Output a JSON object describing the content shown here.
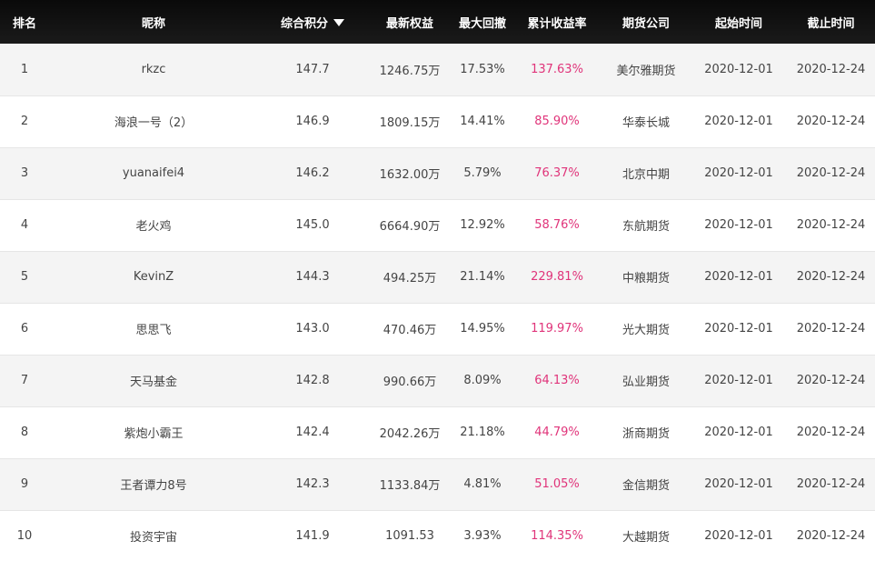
{
  "table": {
    "headers": {
      "rank": "排名",
      "nickname": "昵称",
      "score": "综合积分",
      "equity": "最新权益",
      "drawdown": "最大回撤",
      "return_rate": "累计收益率",
      "broker": "期货公司",
      "start": "起始时间",
      "end": "截止时间"
    },
    "sort_icon": "caret-down-icon",
    "accent_color": "#e0347a",
    "header_bg": "#0c0c0c",
    "rows": [
      {
        "rank": "1",
        "nickname": "rkzc",
        "score": "147.7",
        "equity": "1246.75万",
        "drawdown": "17.53%",
        "return_rate": "137.63%",
        "broker": "美尔雅期货",
        "start": "2020-12-01",
        "end": "2020-12-24"
      },
      {
        "rank": "2",
        "nickname": "海浪一号（2）",
        "score": "146.9",
        "equity": "1809.15万",
        "drawdown": "14.41%",
        "return_rate": "85.90%",
        "broker": "华泰长城",
        "start": "2020-12-01",
        "end": "2020-12-24"
      },
      {
        "rank": "3",
        "nickname": "yuanaifei4",
        "score": "146.2",
        "equity": "1632.00万",
        "drawdown": "5.79%",
        "return_rate": "76.37%",
        "broker": "北京中期",
        "start": "2020-12-01",
        "end": "2020-12-24"
      },
      {
        "rank": "4",
        "nickname": "老火鸡",
        "score": "145.0",
        "equity": "6664.90万",
        "drawdown": "12.92%",
        "return_rate": "58.76%",
        "broker": "东航期货",
        "start": "2020-12-01",
        "end": "2020-12-24"
      },
      {
        "rank": "5",
        "nickname": "KevinZ",
        "score": "144.3",
        "equity": "494.25万",
        "drawdown": "21.14%",
        "return_rate": "229.81%",
        "broker": "中粮期货",
        "start": "2020-12-01",
        "end": "2020-12-24"
      },
      {
        "rank": "6",
        "nickname": "思思飞",
        "score": "143.0",
        "equity": "470.46万",
        "drawdown": "14.95%",
        "return_rate": "119.97%",
        "broker": "光大期货",
        "start": "2020-12-01",
        "end": "2020-12-24"
      },
      {
        "rank": "7",
        "nickname": "天马基金",
        "score": "142.8",
        "equity": "990.66万",
        "drawdown": "8.09%",
        "return_rate": "64.13%",
        "broker": "弘业期货",
        "start": "2020-12-01",
        "end": "2020-12-24"
      },
      {
        "rank": "8",
        "nickname": "紫炮小霸王",
        "score": "142.4",
        "equity": "2042.26万",
        "drawdown": "21.18%",
        "return_rate": "44.79%",
        "broker": "浙商期货",
        "start": "2020-12-01",
        "end": "2020-12-24"
      },
      {
        "rank": "9",
        "nickname": "王者谭力8号",
        "score": "142.3",
        "equity": "1133.84万",
        "drawdown": "4.81%",
        "return_rate": "51.05%",
        "broker": "金信期货",
        "start": "2020-12-01",
        "end": "2020-12-24"
      },
      {
        "rank": "10",
        "nickname": "投资宇宙",
        "score": "141.9",
        "equity": "1091.53",
        "drawdown": "3.93%",
        "return_rate": "114.35%",
        "broker": "大越期货",
        "start": "2020-12-01",
        "end": "2020-12-24"
      }
    ]
  }
}
